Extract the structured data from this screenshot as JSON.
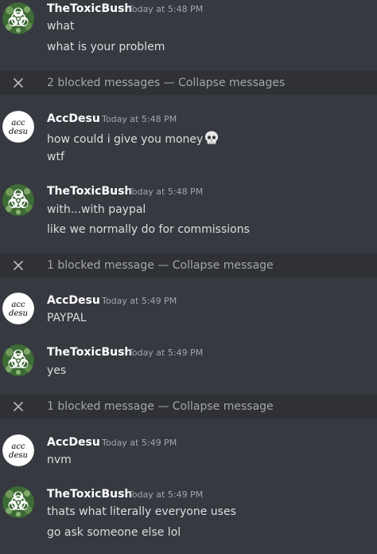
{
  "users": {
    "toxic": "TheToxicBush",
    "acc": "AccDesu"
  },
  "avatars": {
    "acc_text_top": "acc",
    "acc_text_bottom": "desu"
  },
  "groups": [
    {
      "author": "TheToxicBush",
      "timestamp": "Today at 5:48 PM",
      "messages": [
        "what",
        "what is your problem"
      ]
    },
    {
      "author": "AccDesu",
      "timestamp": "Today at 5:48 PM",
      "messages": [
        "how could i give you money",
        "wtf"
      ],
      "emoji": "skull-icon"
    },
    {
      "author": "TheToxicBush",
      "timestamp": "Today at 5:48 PM",
      "messages": [
        "with...with paypal",
        "like we normally do for commissions"
      ]
    },
    {
      "author": "AccDesu",
      "timestamp": "Today at 5:49 PM",
      "messages": [
        "PAYPAL"
      ]
    },
    {
      "author": "TheToxicBush",
      "timestamp": "Today at 5:49 PM",
      "messages": [
        "yes"
      ]
    },
    {
      "author": "AccDesu",
      "timestamp": "Today at 5:49 PM",
      "messages": [
        "nvm"
      ]
    },
    {
      "author": "TheToxicBush",
      "timestamp": "Today at 5:49 PM",
      "messages": [
        "thats what literally everyone uses",
        "go ask someone else lol"
      ]
    }
  ],
  "blocked": [
    {
      "count_text": "2 blocked messages",
      "separator": " — ",
      "action": "Collapse messages"
    },
    {
      "count_text": "1 blocked message",
      "separator": " — ",
      "action": "Collapse message"
    },
    {
      "count_text": "1 blocked message",
      "separator": " — ",
      "action": "Collapse message"
    }
  ],
  "colors": {
    "background": "#36393f",
    "blocked_bar": "#2f3136",
    "username": "#ffffff",
    "timestamp": "#a3a6aa",
    "message": "#dcddde",
    "toxic_avatar_green": "#3f7a3a"
  }
}
